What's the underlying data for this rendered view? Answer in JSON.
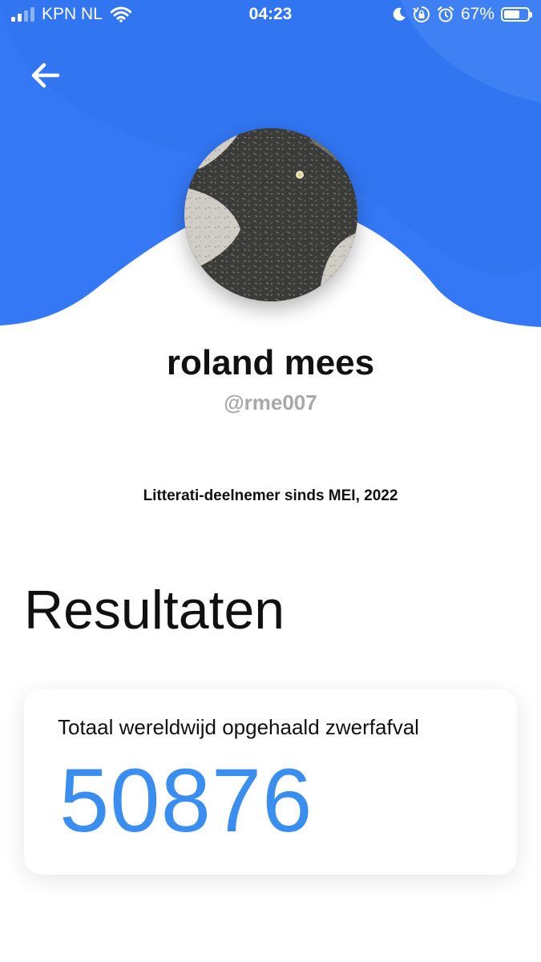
{
  "status_bar": {
    "carrier": "KPN NL",
    "time": "04:23",
    "battery_percent_text": "67%",
    "battery_level": 0.67,
    "icons": [
      "signal-icon",
      "wifi-icon",
      "moon-icon",
      "rotation-lock-icon",
      "alarm-icon",
      "battery-icon"
    ]
  },
  "header": {
    "back_icon": "arrow-left-icon",
    "accent_color": "#3478F6"
  },
  "profile": {
    "name": "roland mees",
    "handle": "@rme007",
    "member_since": "Litterati-deelnemer sinds MEI, 2022"
  },
  "results": {
    "title": "Resultaten",
    "card": {
      "label": "Totaal wereldwijd opgehaald zwerfafval",
      "value": "50876",
      "value_color": "#3A8EF0"
    }
  }
}
